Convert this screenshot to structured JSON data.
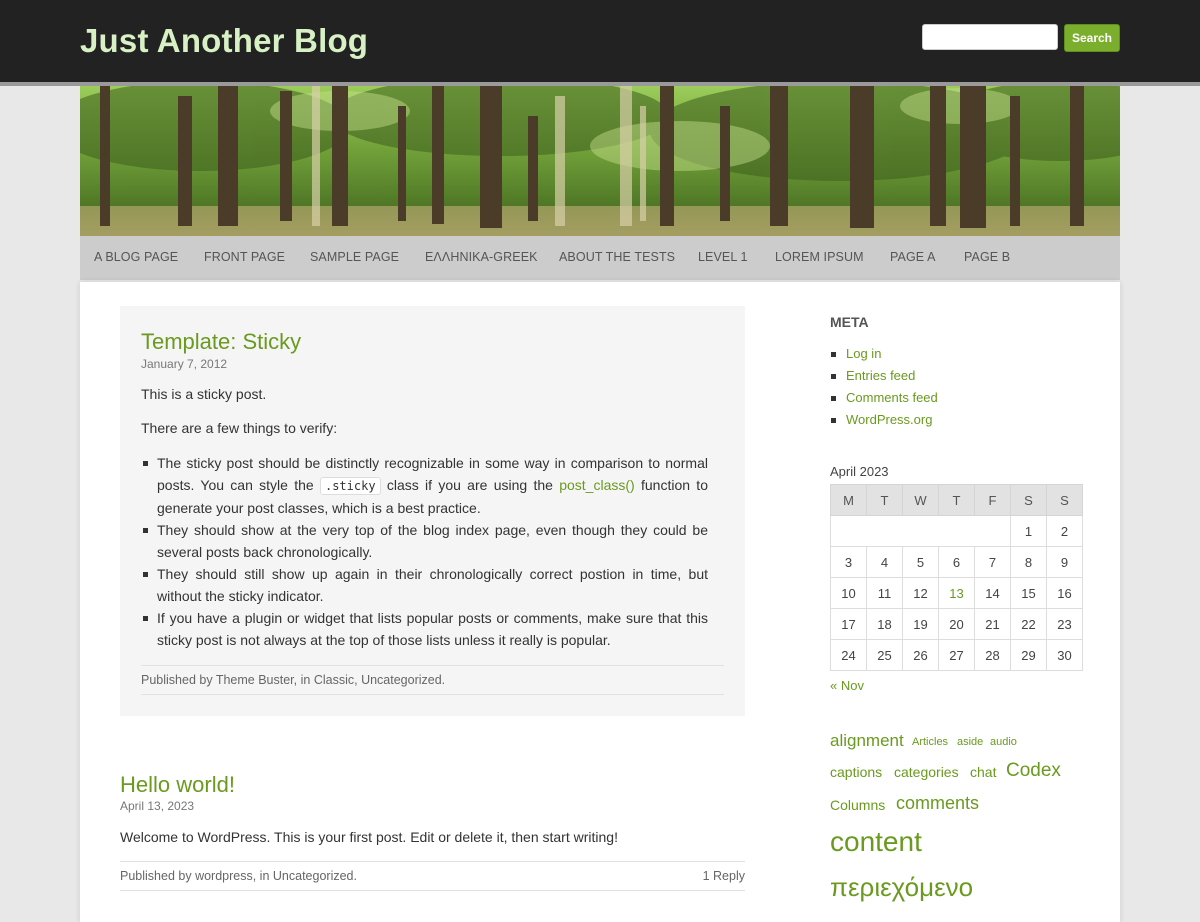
{
  "site": {
    "title": "Just Another Blog"
  },
  "search": {
    "placeholder": "",
    "button_label": "Search"
  },
  "nav": {
    "items": [
      "A BLOG PAGE",
      "FRONT PAGE",
      "SAMPLE PAGE",
      "ΕΛΛΗΝΙΚΑ-GREEK",
      "ABOUT THE TESTS",
      "LEVEL 1",
      "LOREM IPSUM",
      "PAGE A",
      "PAGE B"
    ]
  },
  "posts": [
    {
      "title": "Template: Sticky",
      "date": "January 7, 2012",
      "intro": "This is a sticky post.",
      "subintro": "There are a few things to verify:",
      "list": [
        {
          "pre": "The sticky post should be distinctly recognizable in some way in comparison to normal posts. You can style the ",
          "code": ".sticky",
          "mid": " class if you are using the ",
          "link": "post_class()",
          "post": " function to generate your post classes, which is a best practice."
        },
        {
          "text": "They should show at the very top of the blog index page, even though they could be several posts back chronologically."
        },
        {
          "text": "They should still show up again in their chronologically correct postion in time, but without the sticky indicator."
        },
        {
          "text": "If you have a plugin or widget that lists popular posts or comments, make sure that this sticky post is not always at the top of those lists unless it really is popular."
        }
      ],
      "meta": {
        "prefix": "Published by ",
        "author": "Theme Buster",
        "in": ", in ",
        "cat1": "Classic",
        "sep": ", ",
        "cat2": "Uncategorized",
        "end": "."
      }
    },
    {
      "title": "Hello world!",
      "date": "April 13, 2023",
      "body": "Welcome to WordPress. This is your first post. Edit or delete it, then start writing!",
      "meta": {
        "prefix": "Published by ",
        "author": "wordpress",
        "in": ", in ",
        "cat1": "Uncategorized",
        "end": "."
      },
      "replies": "1 Reply"
    }
  ],
  "sidebar": {
    "meta_title": "META",
    "meta_links": [
      "Log in",
      "Entries feed",
      "Comments feed",
      "WordPress.org"
    ],
    "calendar": {
      "caption": "April 2023",
      "headers": [
        "M",
        "T",
        "W",
        "T",
        "F",
        "S",
        "S"
      ],
      "rows": [
        [
          "",
          "",
          "",
          "",
          "",
          "1",
          "2"
        ],
        [
          "3",
          "4",
          "5",
          "6",
          "7",
          "8",
          "9"
        ],
        [
          "10",
          "11",
          "12",
          "13",
          "14",
          "15",
          "16"
        ],
        [
          "17",
          "18",
          "19",
          "20",
          "21",
          "22",
          "23"
        ],
        [
          "24",
          "25",
          "26",
          "27",
          "28",
          "29",
          "30"
        ]
      ],
      "linked_day": "13",
      "prev": "« Nov"
    },
    "tags": [
      "alignment",
      "Articles",
      "aside",
      "audio",
      "captions",
      "categories",
      "chat",
      "Codex",
      "Columns",
      "comments",
      "content",
      "περιεχόμενο"
    ]
  },
  "colors": {
    "accent": "#6a9a1f",
    "header_bg": "#222222",
    "title": "#d7f0c4",
    "nav_bg": "#cccccc"
  }
}
